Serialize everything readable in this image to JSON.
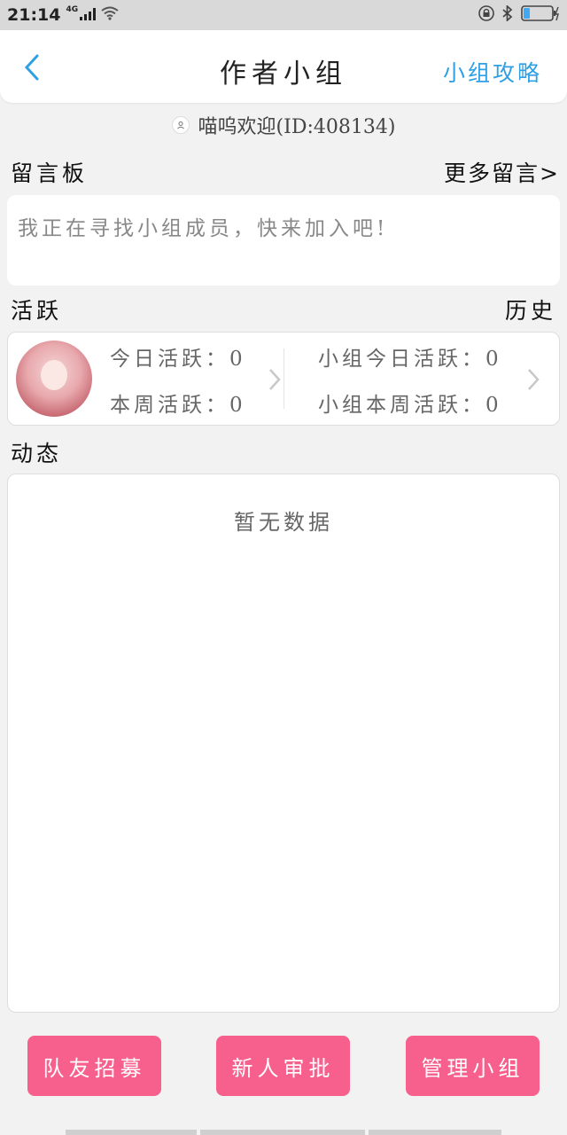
{
  "status_bar": {
    "time": "21:14",
    "network": "4G"
  },
  "header": {
    "title": "作者小组",
    "strategy_link": "小组攻略"
  },
  "welcome": {
    "text": "喵呜欢迎(ID:408134)"
  },
  "board": {
    "title": "留言板",
    "more_link": "更多留言>",
    "placeholder_text": "我正在寻找小组成员，快来加入吧!"
  },
  "activity": {
    "title": "活跃",
    "history_link": "历史",
    "today_label": "今日活跃：0",
    "week_label": "本周活跃：0",
    "group_today_label": "小组今日活跃：0",
    "group_week_label": "小组本周活跃：0"
  },
  "feed": {
    "title": "动态",
    "empty_text": "暂无数据"
  },
  "actions": {
    "recruit": "队友招募",
    "approve": "新人审批",
    "manage": "管理小组"
  },
  "colors": {
    "accent_blue": "#2fa0e6",
    "button_pink": "#f75f8c"
  },
  "icons": [
    "back-arrow-icon",
    "wifi-icon",
    "signal-icon",
    "lock-icon",
    "bluetooth-icon",
    "battery-icon",
    "chevron-right-icon"
  ]
}
